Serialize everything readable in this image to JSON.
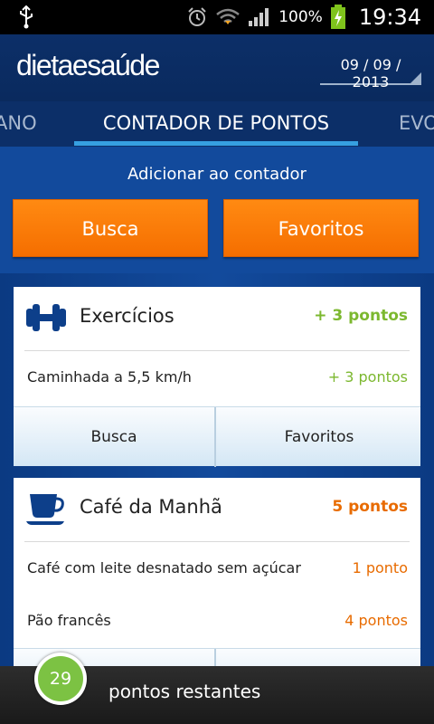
{
  "status": {
    "battery_pct": "100%",
    "time": "19:34"
  },
  "header": {
    "logo_main": "dietaesa",
    "logo_u": "ú",
    "logo_end": "de",
    "date": "09 / 09 / 2013"
  },
  "tabs": {
    "left": "ANO",
    "active": "CONTADOR DE PONTOS",
    "right": "EVO"
  },
  "add": {
    "label": "Adicionar ao contador",
    "search_button": "Busca",
    "favorites_button": "Favoritos"
  },
  "cards": [
    {
      "title": "Exercícios",
      "points": "+ 3 pontos",
      "items": [
        {
          "label": "Caminhada a 5,5 km/h",
          "points": "+ 3 pontos"
        }
      ],
      "search_button": "Busca",
      "favorites_button": "Favoritos"
    },
    {
      "title": "Café da Manhã",
      "points": "5 pontos",
      "items": [
        {
          "label": "Café com leite desnatado sem açúcar",
          "points": "1 ponto"
        },
        {
          "label": "Pão francês",
          "points": "4 pontos"
        }
      ]
    }
  ],
  "footer": {
    "remaining_count": "29",
    "remaining_label": "pontos restantes"
  },
  "colors": {
    "brand_blue": "#0c2f68",
    "accent_orange": "#f56e00",
    "points_green": "#7cb82f",
    "points_orange": "#e86b00",
    "tab_indicator": "#36a0e1"
  },
  "icons": {
    "usb": "usb-icon",
    "alarm": "alarm-icon",
    "wifi": "wifi-icon",
    "signal": "signal-icon",
    "battery": "battery-charging-icon",
    "dumbbell": "dumbbell-icon",
    "coffee": "coffee-cup-icon"
  }
}
